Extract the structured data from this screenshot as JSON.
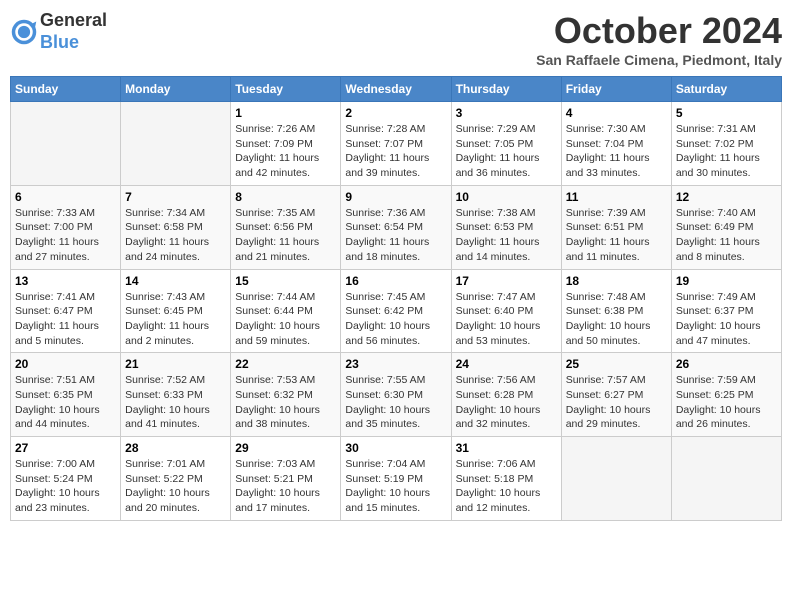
{
  "header": {
    "logo_general": "General",
    "logo_blue": "Blue",
    "month": "October 2024",
    "location": "San Raffaele Cimena, Piedmont, Italy"
  },
  "weekdays": [
    "Sunday",
    "Monday",
    "Tuesday",
    "Wednesday",
    "Thursday",
    "Friday",
    "Saturday"
  ],
  "weeks": [
    [
      null,
      null,
      {
        "day": 1,
        "sunrise": "7:26 AM",
        "sunset": "7:09 PM",
        "daylight": "11 hours and 42 minutes."
      },
      {
        "day": 2,
        "sunrise": "7:28 AM",
        "sunset": "7:07 PM",
        "daylight": "11 hours and 39 minutes."
      },
      {
        "day": 3,
        "sunrise": "7:29 AM",
        "sunset": "7:05 PM",
        "daylight": "11 hours and 36 minutes."
      },
      {
        "day": 4,
        "sunrise": "7:30 AM",
        "sunset": "7:04 PM",
        "daylight": "11 hours and 33 minutes."
      },
      {
        "day": 5,
        "sunrise": "7:31 AM",
        "sunset": "7:02 PM",
        "daylight": "11 hours and 30 minutes."
      }
    ],
    [
      {
        "day": 6,
        "sunrise": "7:33 AM",
        "sunset": "7:00 PM",
        "daylight": "11 hours and 27 minutes."
      },
      {
        "day": 7,
        "sunrise": "7:34 AM",
        "sunset": "6:58 PM",
        "daylight": "11 hours and 24 minutes."
      },
      {
        "day": 8,
        "sunrise": "7:35 AM",
        "sunset": "6:56 PM",
        "daylight": "11 hours and 21 minutes."
      },
      {
        "day": 9,
        "sunrise": "7:36 AM",
        "sunset": "6:54 PM",
        "daylight": "11 hours and 18 minutes."
      },
      {
        "day": 10,
        "sunrise": "7:38 AM",
        "sunset": "6:53 PM",
        "daylight": "11 hours and 14 minutes."
      },
      {
        "day": 11,
        "sunrise": "7:39 AM",
        "sunset": "6:51 PM",
        "daylight": "11 hours and 11 minutes."
      },
      {
        "day": 12,
        "sunrise": "7:40 AM",
        "sunset": "6:49 PM",
        "daylight": "11 hours and 8 minutes."
      }
    ],
    [
      {
        "day": 13,
        "sunrise": "7:41 AM",
        "sunset": "6:47 PM",
        "daylight": "11 hours and 5 minutes."
      },
      {
        "day": 14,
        "sunrise": "7:43 AM",
        "sunset": "6:45 PM",
        "daylight": "11 hours and 2 minutes."
      },
      {
        "day": 15,
        "sunrise": "7:44 AM",
        "sunset": "6:44 PM",
        "daylight": "10 hours and 59 minutes."
      },
      {
        "day": 16,
        "sunrise": "7:45 AM",
        "sunset": "6:42 PM",
        "daylight": "10 hours and 56 minutes."
      },
      {
        "day": 17,
        "sunrise": "7:47 AM",
        "sunset": "6:40 PM",
        "daylight": "10 hours and 53 minutes."
      },
      {
        "day": 18,
        "sunrise": "7:48 AM",
        "sunset": "6:38 PM",
        "daylight": "10 hours and 50 minutes."
      },
      {
        "day": 19,
        "sunrise": "7:49 AM",
        "sunset": "6:37 PM",
        "daylight": "10 hours and 47 minutes."
      }
    ],
    [
      {
        "day": 20,
        "sunrise": "7:51 AM",
        "sunset": "6:35 PM",
        "daylight": "10 hours and 44 minutes."
      },
      {
        "day": 21,
        "sunrise": "7:52 AM",
        "sunset": "6:33 PM",
        "daylight": "10 hours and 41 minutes."
      },
      {
        "day": 22,
        "sunrise": "7:53 AM",
        "sunset": "6:32 PM",
        "daylight": "10 hours and 38 minutes."
      },
      {
        "day": 23,
        "sunrise": "7:55 AM",
        "sunset": "6:30 PM",
        "daylight": "10 hours and 35 minutes."
      },
      {
        "day": 24,
        "sunrise": "7:56 AM",
        "sunset": "6:28 PM",
        "daylight": "10 hours and 32 minutes."
      },
      {
        "day": 25,
        "sunrise": "7:57 AM",
        "sunset": "6:27 PM",
        "daylight": "10 hours and 29 minutes."
      },
      {
        "day": 26,
        "sunrise": "7:59 AM",
        "sunset": "6:25 PM",
        "daylight": "10 hours and 26 minutes."
      }
    ],
    [
      {
        "day": 27,
        "sunrise": "7:00 AM",
        "sunset": "5:24 PM",
        "daylight": "10 hours and 23 minutes."
      },
      {
        "day": 28,
        "sunrise": "7:01 AM",
        "sunset": "5:22 PM",
        "daylight": "10 hours and 20 minutes."
      },
      {
        "day": 29,
        "sunrise": "7:03 AM",
        "sunset": "5:21 PM",
        "daylight": "10 hours and 17 minutes."
      },
      {
        "day": 30,
        "sunrise": "7:04 AM",
        "sunset": "5:19 PM",
        "daylight": "10 hours and 15 minutes."
      },
      {
        "day": 31,
        "sunrise": "7:06 AM",
        "sunset": "5:18 PM",
        "daylight": "10 hours and 12 minutes."
      },
      null,
      null
    ]
  ],
  "labels": {
    "sunrise": "Sunrise:",
    "sunset": "Sunset:",
    "daylight": "Daylight:"
  }
}
